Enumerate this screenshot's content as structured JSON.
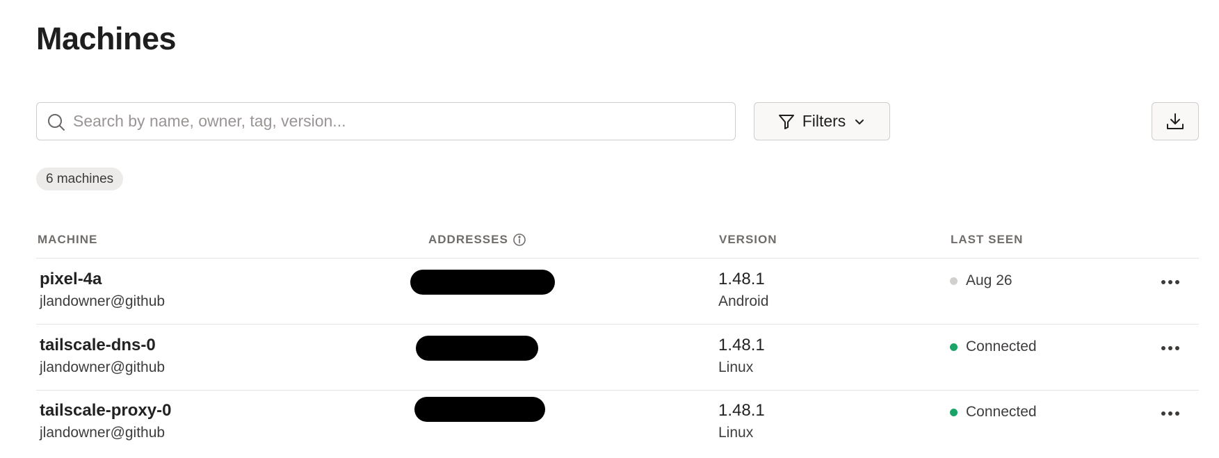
{
  "page": {
    "title": "Machines"
  },
  "search": {
    "placeholder": "Search by name, owner, tag, version...",
    "value": "",
    "icon": "search-icon"
  },
  "toolbar": {
    "filters_label": "Filters",
    "filters_icon": "filter-icon",
    "filters_chevron_icon": "chevron-down-icon",
    "download_icon": "download-icon"
  },
  "summary": {
    "count_label": "6 machines"
  },
  "table": {
    "columns": [
      "MACHINE",
      "ADDRESSES",
      "VERSION",
      "LAST SEEN"
    ],
    "addresses_info_icon": "info-icon",
    "rows": [
      {
        "name": "pixel-4a",
        "owner": "jlandowner@github",
        "addresses_redacted": true,
        "version": "1.48.1",
        "os": "Android",
        "last_seen": "Aug 26",
        "status_color": "#d2d0cf"
      },
      {
        "name": "tailscale-dns-0",
        "owner": "jlandowner@github",
        "addresses_redacted": true,
        "version": "1.48.1",
        "os": "Linux",
        "last_seen": "Connected",
        "status_color": "#1aa468"
      },
      {
        "name": "tailscale-proxy-0",
        "owner": "jlandowner@github",
        "addresses_redacted": true,
        "version": "1.48.1",
        "os": "Linux",
        "last_seen": "Connected",
        "status_color": "#1aa468"
      }
    ]
  },
  "colors": {
    "connected": "#1aa468",
    "offline": "#d2d0cf",
    "badge_bg": "#edebea",
    "border": "#cfcccb"
  }
}
